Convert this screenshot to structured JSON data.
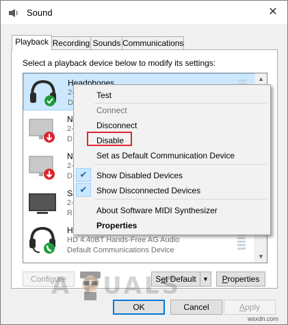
{
  "window": {
    "title": "Sound",
    "close_glyph": "✕"
  },
  "tabs": [
    {
      "label": "Playback",
      "active": true
    },
    {
      "label": "Recording",
      "active": false
    },
    {
      "label": "Sounds",
      "active": false
    },
    {
      "label": "Communications",
      "active": false
    }
  ],
  "instruction": "Select a playback device below to modify its settings:",
  "devices": [
    {
      "name": "Headphones",
      "desc": "2-",
      "status": "De",
      "icon": "headphones-icon",
      "badge": "check-badge-icon",
      "selected": true
    },
    {
      "name": "N",
      "desc": "2-",
      "status": "D",
      "icon": "speaker-monitor-icon",
      "badge": "disabled-arrow-badge-icon",
      "selected": false
    },
    {
      "name": "N",
      "desc": "2-",
      "status": "D",
      "icon": "speaker-monitor-icon",
      "badge": "disabled-arrow-badge-icon",
      "selected": false
    },
    {
      "name": "Sa",
      "desc": "2-",
      "status": "R",
      "icon": "tv-monitor-icon",
      "badge": "",
      "selected": false
    },
    {
      "name": "H",
      "desc": "HD 4.40BT Hands-Free AG Audio",
      "status": "Default Communications Device",
      "icon": "headset-icon",
      "badge": "phone-badge-icon",
      "selected": false
    }
  ],
  "buttons": {
    "configure": "Configure",
    "set_default_prefix": "S",
    "set_default_u": "e",
    "set_default_rest": "t Default",
    "properties_u": "P",
    "properties_rest": "roperties",
    "ok": "OK",
    "cancel": "Cancel",
    "apply_u": "A",
    "apply_rest": "pply"
  },
  "context_menu": {
    "items": [
      {
        "label": "Test",
        "state": "normal"
      },
      {
        "label": "Connect",
        "state": "disabled"
      },
      {
        "label": "Disconnect",
        "state": "normal"
      },
      {
        "label": "Disable",
        "state": "highlighted"
      },
      {
        "label": "Set as Default Communication Device",
        "state": "normal"
      },
      {
        "label": "Show Disabled Devices",
        "state": "checked"
      },
      {
        "label": "Show Disconnected Devices",
        "state": "checked"
      },
      {
        "label": "About Software MIDI Synthesizer",
        "state": "normal"
      },
      {
        "label": "Properties",
        "state": "bold"
      }
    ],
    "check_glyph": "✔"
  },
  "watermark": "A  PUALS",
  "source_label": "wsxdn.com",
  "colors": {
    "highlight_box": "#e2252f",
    "selection": "#cce8ff",
    "accent": "#0078d7",
    "check_badge": "#1e9e3a",
    "disabled_badge": "#d9262c"
  }
}
